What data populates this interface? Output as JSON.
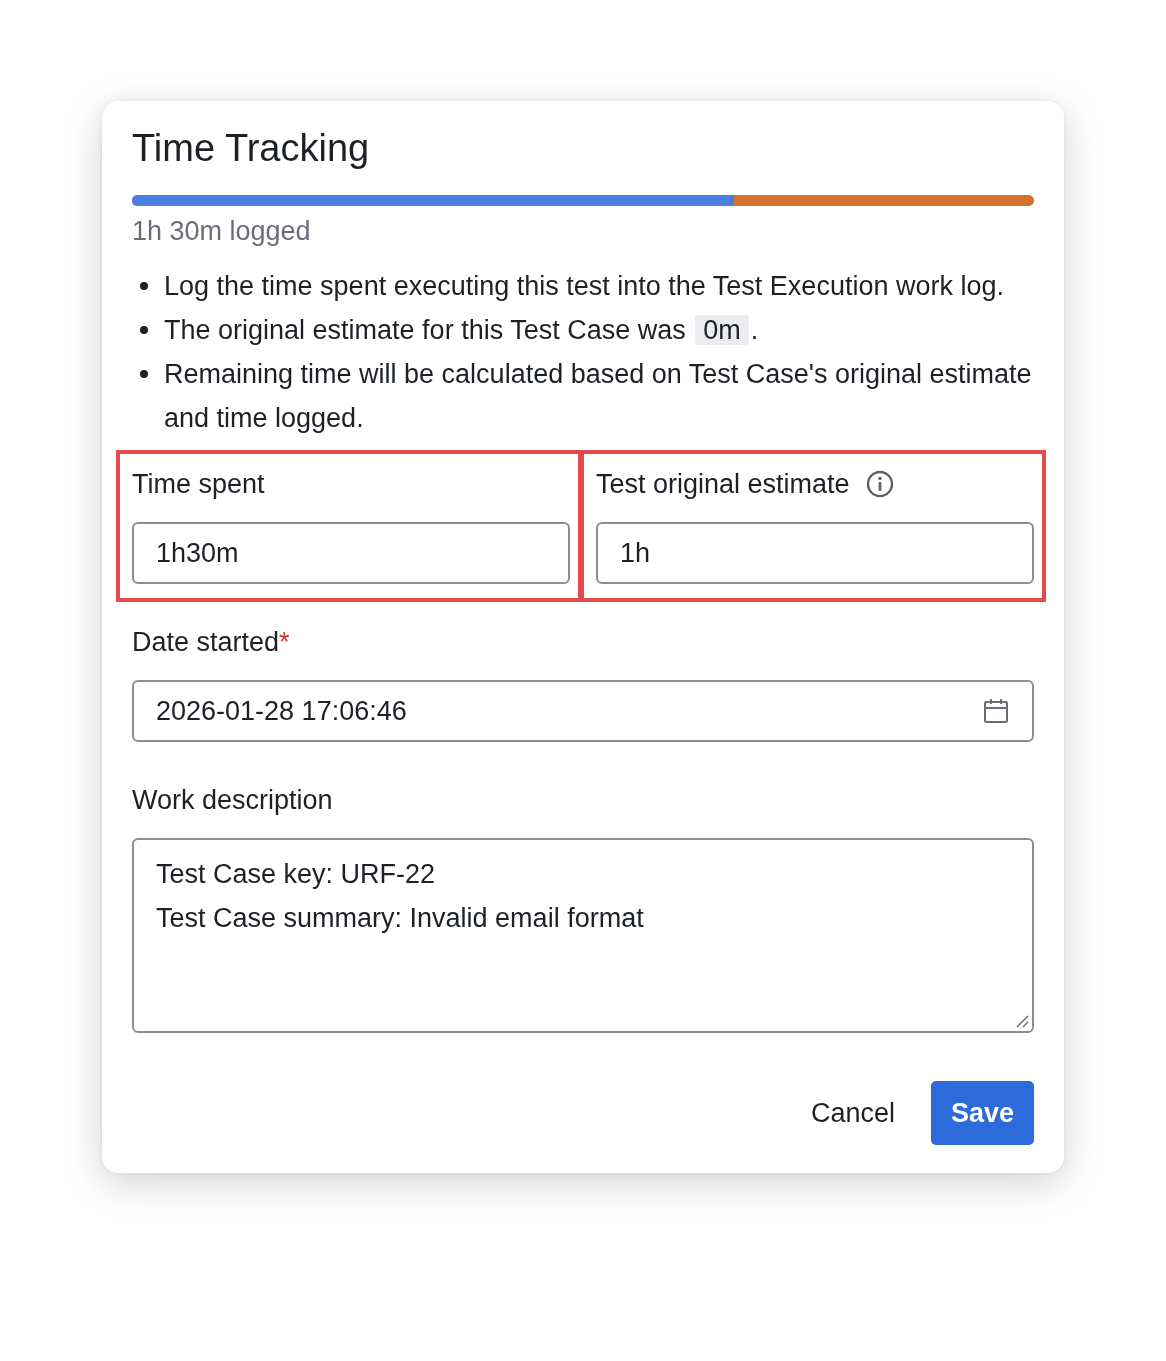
{
  "dialog": {
    "title": "Time Tracking",
    "progress": {
      "level": 0.667,
      "caption": "1h 30m logged"
    },
    "notes": [
      {
        "text": "Log the time spent executing this test into the Test Execution work log."
      },
      {
        "text": "The original estimate for this Test Case was ",
        "code": "0m",
        "after": "."
      },
      {
        "text": "Remaining time will be calculated based on Test Case's original estimate and time logged."
      }
    ],
    "time_fields": [
      {
        "label": "Time spent",
        "value": "1h30m",
        "info": false,
        "highlighted": true
      },
      {
        "label": "Test original estimate",
        "value": "1h",
        "info": true,
        "highlighted": true
      }
    ],
    "date_started": {
      "label": "Date started",
      "required_mark": "*",
      "value": "2026-01-28 17:06:46"
    },
    "work_description": {
      "label": "Work description",
      "lines": [
        "Test Case key: URF-22",
        "Test Case summary: Invalid email format"
      ]
    },
    "buttons": [
      {
        "label": "Cancel",
        "kind": "subtle"
      },
      {
        "label": "Save",
        "kind": "primary"
      }
    ]
  }
}
